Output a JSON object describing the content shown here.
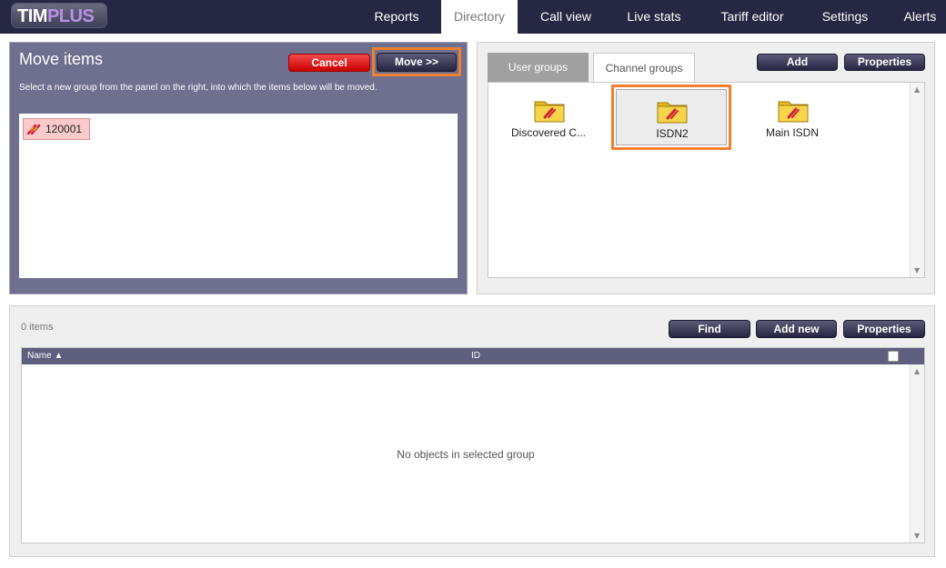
{
  "app": {
    "logo_main": "TIM",
    "logo_accent": "PLUS"
  },
  "nav": {
    "items": [
      {
        "label": "Reports",
        "active": false
      },
      {
        "label": "Directory",
        "active": true
      },
      {
        "label": "Call view",
        "active": false
      },
      {
        "label": "Live stats",
        "active": false
      },
      {
        "label": "Tariff editor",
        "active": false
      },
      {
        "label": "Settings",
        "active": false
      },
      {
        "label": "Alerts",
        "active": false
      }
    ]
  },
  "move_panel": {
    "title": "Move items",
    "description": "Select a new group from the panel on the right, into which the items below will be moved.",
    "cancel_label": "Cancel",
    "move_label": "Move  >>",
    "items": [
      {
        "label": "120001",
        "icon": "channel-icon"
      }
    ]
  },
  "groups_panel": {
    "tabs": [
      {
        "label": "User groups",
        "active": false
      },
      {
        "label": "Channel groups",
        "active": true
      }
    ],
    "add_label": "Add",
    "properties_label": "Properties",
    "folders": [
      {
        "label": "Discovered C...",
        "selected": false,
        "icon": "folder-channel-icon"
      },
      {
        "label": "ISDN2",
        "selected": true,
        "icon": "folder-channel-icon"
      },
      {
        "label": "Main ISDN",
        "selected": false,
        "icon": "folder-channel-icon"
      }
    ]
  },
  "items_panel": {
    "count_text": "0 items",
    "find_label": "Find",
    "add_new_label": "Add new",
    "properties_label": "Properties",
    "columns": [
      {
        "label": "Name ▲"
      },
      {
        "label": "ID"
      }
    ],
    "empty_text": "No objects in selected group"
  },
  "colors": {
    "topbar": "#262742",
    "panel_purple": "#6f6f8f",
    "highlight_orange": "#f07f2f",
    "chip_pink": "#f9c9cc",
    "cancel_red": "#e01818"
  }
}
